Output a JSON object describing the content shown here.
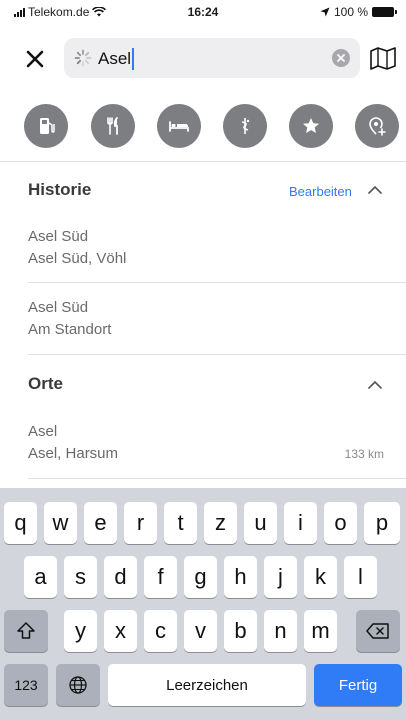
{
  "status_bar": {
    "carrier": "Telekom.de",
    "time": "16:24",
    "battery": "100 %"
  },
  "search": {
    "query": "Asel"
  },
  "categories": [
    "gas-station-icon",
    "restaurant-icon",
    "hotel-icon",
    "pharmacy-icon",
    "favorites-icon",
    "add-place-icon"
  ],
  "history": {
    "title": "Historie",
    "edit_label": "Bearbeiten",
    "items": [
      {
        "line1": "Asel Süd",
        "line2": "Asel Süd, Vöhl"
      },
      {
        "line1": "Asel Süd",
        "line2": "Am Standort"
      }
    ]
  },
  "places": {
    "title": "Orte",
    "items": [
      {
        "line1": "Asel",
        "line2": "Asel, Harsum",
        "distance": "133 km"
      }
    ]
  },
  "keyboard": {
    "row1": [
      "q",
      "w",
      "e",
      "r",
      "t",
      "z",
      "u",
      "i",
      "o",
      "p"
    ],
    "row2": [
      "a",
      "s",
      "d",
      "f",
      "g",
      "h",
      "j",
      "k",
      "l"
    ],
    "row3": [
      "y",
      "x",
      "c",
      "v",
      "b",
      "n",
      "m"
    ],
    "numbers_label": "123",
    "space_label": "Leerzeichen",
    "done_label": "Fertig"
  }
}
